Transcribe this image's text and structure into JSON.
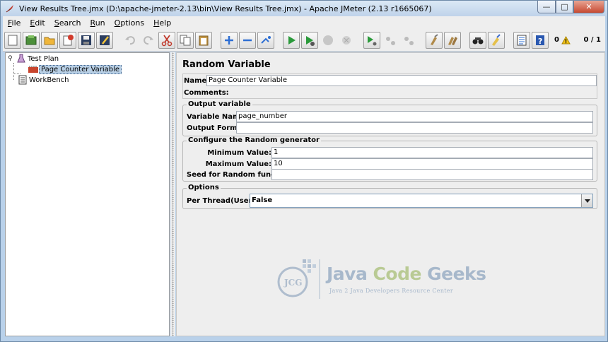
{
  "window": {
    "title": "View Results Tree.jmx (D:\\apache-jmeter-2.13\\bin\\View Results Tree.jmx) - Apache JMeter (2.13 r1665067)",
    "controls": {
      "minimize": "—",
      "maximize": "□",
      "close": "✕"
    }
  },
  "menu": [
    {
      "mnemonic": "F",
      "rest": "ile"
    },
    {
      "mnemonic": "E",
      "rest": "dit"
    },
    {
      "mnemonic": "S",
      "rest": "earch"
    },
    {
      "mnemonic": "R",
      "rest": "un"
    },
    {
      "mnemonic": "O",
      "rest": "ptions"
    },
    {
      "mnemonic": "H",
      "rest": "elp"
    }
  ],
  "toolbar": {
    "buttons": [
      "new-icon",
      "templates-icon",
      "open-icon",
      "close-file-icon",
      "save-icon",
      "save-as-icon",
      "undo-icon",
      "redo-icon",
      "cut-icon",
      "copy-icon",
      "paste-icon",
      "expand-icon",
      "collapse-icon",
      "toggle-icon",
      "start-icon",
      "start-no-pause-icon",
      "stop-icon",
      "shutdown-icon",
      "remote-start-icon",
      "remote-stop-icon",
      "remote-shutdown-icon",
      "clear-icon",
      "clear-all-icon",
      "search-icon",
      "reset-search-icon",
      "function-helper-icon",
      "help-icon"
    ],
    "error_count": "0",
    "thread_ratio": "0 / 1",
    "warning_icon": "warning-icon"
  },
  "tree": {
    "test_plan": "Test Plan",
    "child": "Page Counter Variable",
    "workbench": "WorkBench"
  },
  "panel": {
    "title": "Random Variable",
    "name_label": "Name:",
    "name_value": "Page Counter Variable",
    "comments_label": "Comments:",
    "comments_value": "",
    "output": {
      "legend": "Output variable",
      "variable_name_label": "Variable Name:",
      "variable_name_value": "page_number",
      "output_format_label": "Output Format:",
      "output_format_value": ""
    },
    "generator": {
      "legend": "Configure the Random generator",
      "min_label": "Minimum Value:",
      "min_value": "1",
      "max_label": "Maximum Value:",
      "max_value": "10",
      "seed_label": "Seed for Random function:",
      "seed_value": ""
    },
    "options": {
      "legend": "Options",
      "per_thread_label": "Per Thread(User) ?:",
      "per_thread_value": "False"
    }
  },
  "watermark": {
    "java": "Java ",
    "code": "Code ",
    "geeks": "Geeks",
    "tagline": "Java 2 Java Developers Resource Center",
    "badge": "JCG"
  }
}
